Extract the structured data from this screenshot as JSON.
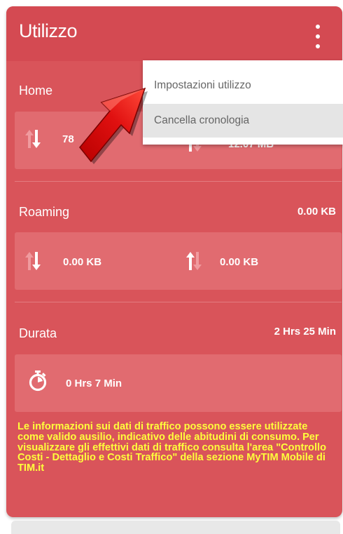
{
  "header": {
    "title": "Utilizzo"
  },
  "menu": {
    "items": [
      "Impostazioni utilizzo",
      "Cancella cronologia"
    ]
  },
  "home": {
    "label": "Home",
    "download": "78",
    "upload": "12.07 MB"
  },
  "roaming": {
    "label": "Roaming",
    "total": "0.00 KB",
    "download": "0.00 KB",
    "upload": "0.00 KB"
  },
  "durata": {
    "label": "Durata",
    "total": "2 Hrs 25 Min",
    "value": "0 Hrs 7 Min"
  },
  "notice": "Le informazioni sui dati di traffico possono essere utilizzate come valido ausilio, indicativo delle abitudini di consumo. Per visualizzare gli effettivi dati di traffico consulta l'area \"Controllo Costi - Dettaglio e Costi Traffico\" della sezione MyTIM Mobile di TIM.it",
  "colors": {
    "card": "#d9545a",
    "box": "#e16b70",
    "notice": "#ffff3b"
  },
  "icons": [
    "kebab-menu-icon",
    "download-arrows-icon",
    "upload-arrows-icon",
    "stopwatch-icon",
    "red-pointer-arrow"
  ]
}
